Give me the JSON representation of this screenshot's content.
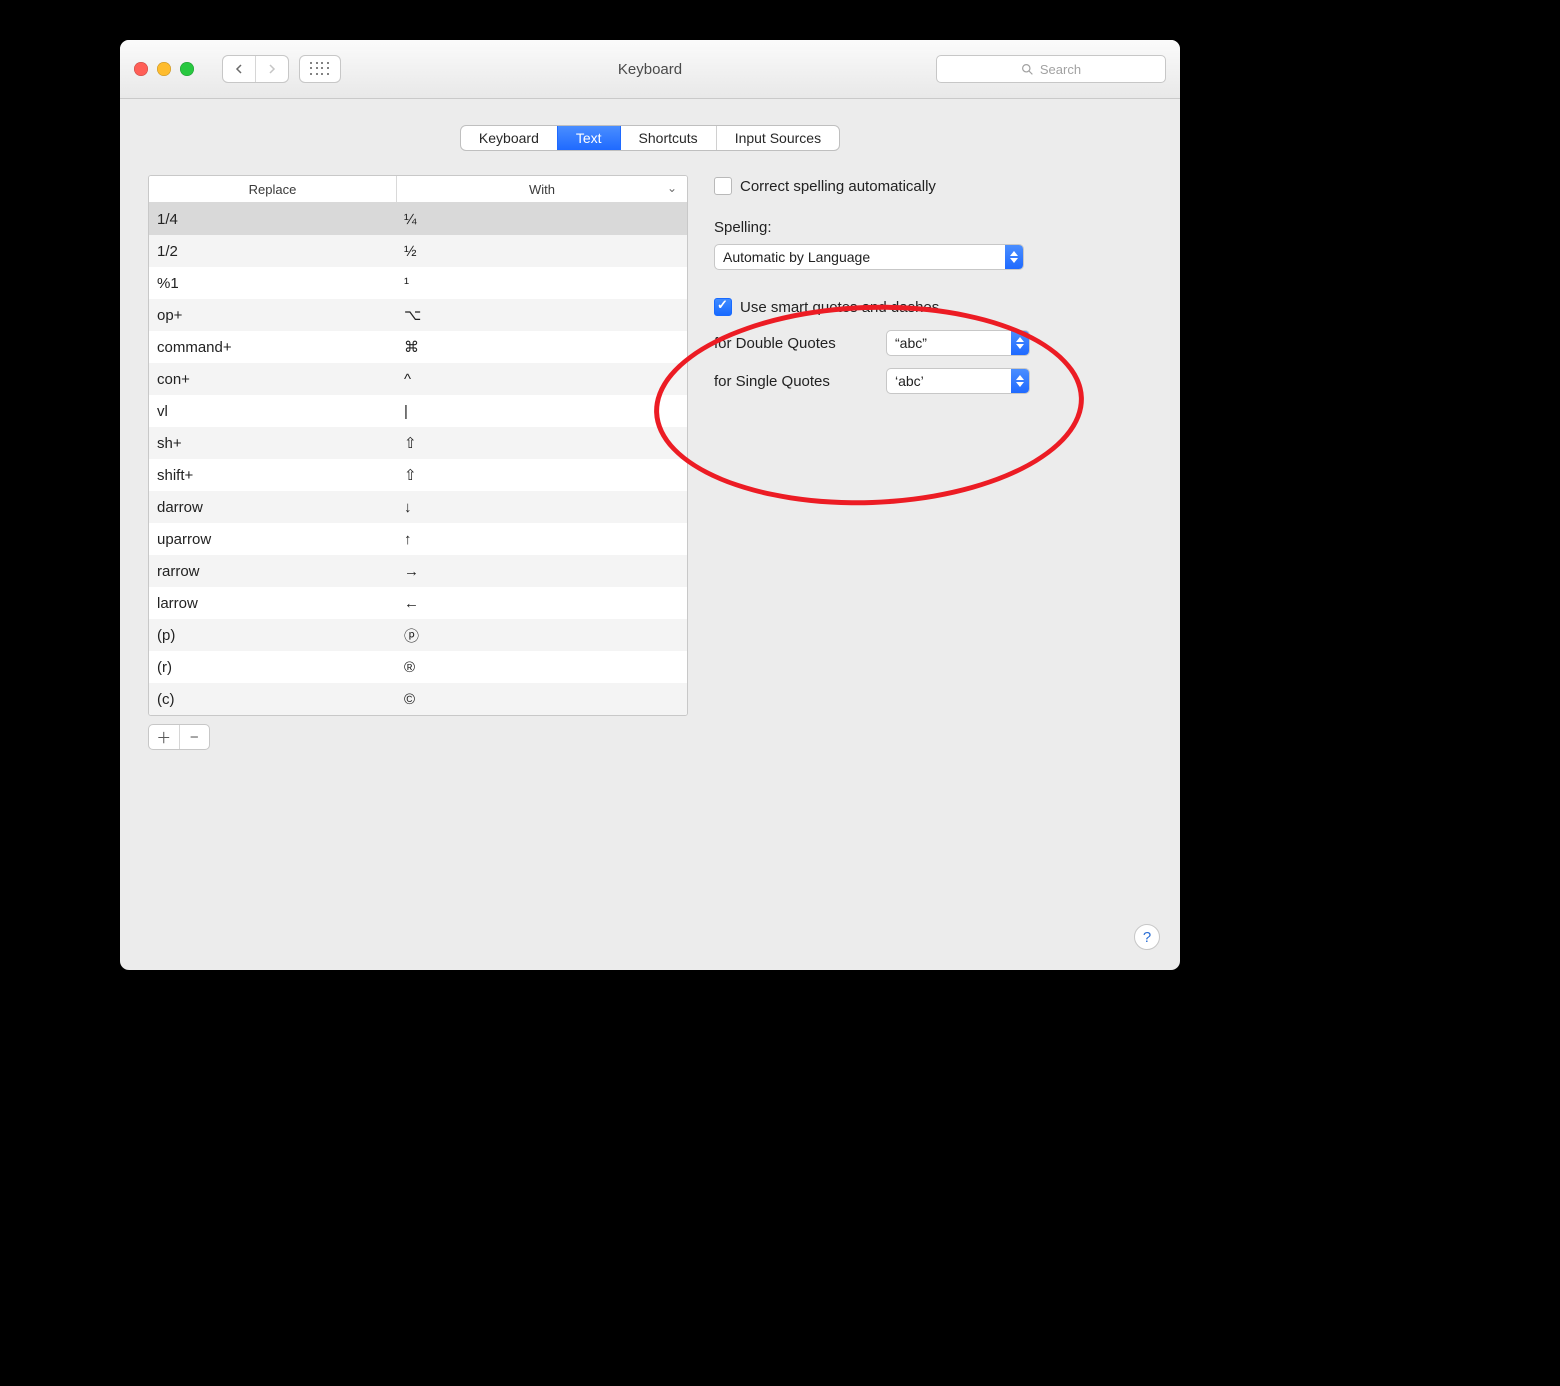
{
  "title": "Keyboard",
  "search_placeholder": "Search",
  "tabs": {
    "t0": "Keyboard",
    "t1": "Text",
    "t2": "Shortcuts",
    "t3": "Input Sources"
  },
  "columns": {
    "replace": "Replace",
    "with": "With"
  },
  "rows": [
    {
      "r": "1/4",
      "w": "¼"
    },
    {
      "r": "1/2",
      "w": "½"
    },
    {
      "r": "%1",
      "w": "¹"
    },
    {
      "r": "op+",
      "w": "⌥"
    },
    {
      "r": "command+",
      "w": "⌘"
    },
    {
      "r": "con+",
      "w": "^"
    },
    {
      "r": "vl",
      "w": "|"
    },
    {
      "r": "sh+",
      "w": "⇧"
    },
    {
      "r": "shift+",
      "w": "⇧"
    },
    {
      "r": "darrow",
      "w": "↓"
    },
    {
      "r": "uparrow",
      "w": "↑"
    },
    {
      "r": "rarrow",
      "w": "→"
    },
    {
      "r": "larrow",
      "w": "←"
    },
    {
      "r": "(p)",
      "w": "ⓟ"
    },
    {
      "r": "(r)",
      "w": "®"
    },
    {
      "r": "(c)",
      "w": "©"
    }
  ],
  "right": {
    "correct": "Correct spelling automatically",
    "spelling_label": "Spelling:",
    "spelling_value": "Automatic by Language",
    "smart": "Use smart quotes and dashes",
    "double_label": "for Double Quotes",
    "double_value": "“abc”",
    "single_label": "for Single Quotes",
    "single_value": "‘abc’"
  },
  "help": "?"
}
